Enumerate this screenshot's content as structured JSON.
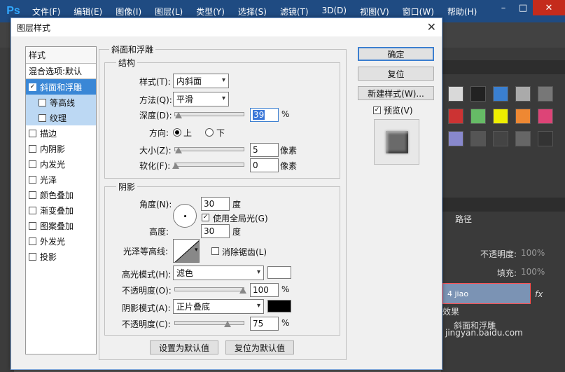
{
  "app": {
    "logo": "Ps",
    "menu": [
      "文件(F)",
      "编辑(E)",
      "图像(I)",
      "图层(L)",
      "类型(Y)",
      "选择(S)",
      "滤镜(T)",
      "3D(D)",
      "视图(V)",
      "窗口(W)",
      "帮助(H)"
    ],
    "window_controls": [
      "–",
      "□",
      "✕"
    ]
  },
  "right_panel": {
    "paths_tab": "路径",
    "opacity_label": "不透明度:",
    "opacity_value": "100%",
    "fill_label": "填充:",
    "fill_value": "100%",
    "layer_name": "4 jiao",
    "effects_label": "效果",
    "effect_item": "斜面和浮雕",
    "fx": "fx"
  },
  "dialog": {
    "title": "图层样式",
    "close": "✕",
    "styles_header": "样式",
    "blend_options": "混合选项:默认",
    "styles": [
      {
        "label": "斜面和浮雕",
        "checked": true,
        "selected": true,
        "sub": false
      },
      {
        "label": "等高线",
        "checked": false,
        "selected": false,
        "sub": true
      },
      {
        "label": "纹理",
        "checked": false,
        "selected": false,
        "sub": true
      },
      {
        "label": "描边",
        "checked": false,
        "selected": false,
        "sub": false
      },
      {
        "label": "内阴影",
        "checked": false,
        "selected": false,
        "sub": false
      },
      {
        "label": "内发光",
        "checked": false,
        "selected": false,
        "sub": false
      },
      {
        "label": "光泽",
        "checked": false,
        "selected": false,
        "sub": false
      },
      {
        "label": "颜色叠加",
        "checked": false,
        "selected": false,
        "sub": false
      },
      {
        "label": "渐变叠加",
        "checked": false,
        "selected": false,
        "sub": false
      },
      {
        "label": "图案叠加",
        "checked": false,
        "selected": false,
        "sub": false
      },
      {
        "label": "外发光",
        "checked": false,
        "selected": false,
        "sub": false
      },
      {
        "label": "投影",
        "checked": false,
        "selected": false,
        "sub": false
      }
    ],
    "bevel": {
      "group_title": "斜面和浮雕",
      "structure_title": "结构",
      "style_label": "样式(T):",
      "style_value": "内斜面",
      "technique_label": "方法(Q):",
      "technique_value": "平滑",
      "depth_label": "深度(D):",
      "depth_value": "39",
      "depth_unit": "%",
      "direction_label": "方向:",
      "dir_up": "上",
      "dir_down": "下",
      "size_label": "大小(Z):",
      "size_value": "5",
      "size_unit": "像素",
      "soften_label": "软化(F):",
      "soften_value": "0",
      "soften_unit": "像素",
      "shading_title": "阴影",
      "angle_label": "角度(N):",
      "angle_value": "30",
      "angle_unit": "度",
      "global_light": "使用全局光(G)",
      "altitude_label": "高度:",
      "altitude_value": "30",
      "altitude_unit": "度",
      "gloss_label": "光泽等高线:",
      "antialias": "消除锯齿(L)",
      "highlight_label": "高光模式(H):",
      "highlight_value": "滤色",
      "highlight_color": "#ffffff",
      "hl_opacity_label": "不透明度(O):",
      "hl_opacity_value": "100",
      "shadow_label": "阴影模式(A):",
      "shadow_value": "正片叠底",
      "shadow_color": "#000000",
      "sh_opacity_label": "不透明度(C):",
      "sh_opacity_value": "75",
      "percent": "%",
      "make_default": "设置为默认值",
      "reset_default": "复位为默认值"
    },
    "buttons": {
      "ok": "确定",
      "reset": "复位",
      "new_style": "新建样式(W)...",
      "preview": "预览(V)"
    }
  },
  "watermark": "jingyan.baidu.com"
}
